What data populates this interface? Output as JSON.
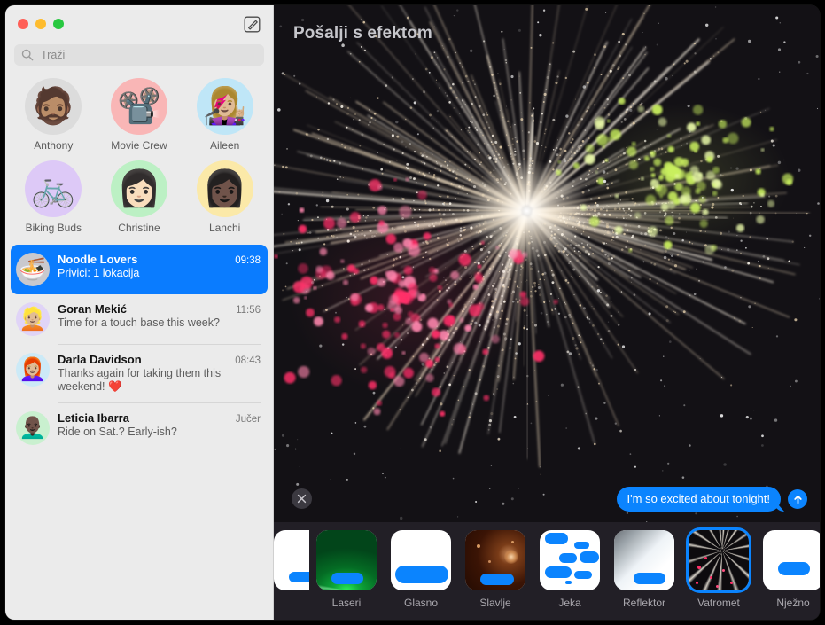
{
  "window": {
    "traffic_lights": [
      "close",
      "minimize",
      "zoom"
    ],
    "compose_icon": "compose-icon"
  },
  "sidebar": {
    "search": {
      "placeholder": "Traži",
      "value": "",
      "icon": "search-icon"
    },
    "pinned": [
      {
        "label": "Anthony",
        "glyph": "🧔🏽",
        "bg": "#dcdcdc"
      },
      {
        "label": "Movie Crew",
        "glyph": "📽️",
        "bg": "#f9b6b6"
      },
      {
        "label": "Aileen",
        "glyph": "👩🏼‍🎤",
        "bg": "#bfe6f7"
      },
      {
        "label": "Biking Buds",
        "glyph": "🚲",
        "bg": "#ddc9f7"
      },
      {
        "label": "Christine",
        "glyph": "👩🏻",
        "bg": "#bcf0c4"
      },
      {
        "label": "Lanchi",
        "glyph": "👩🏿",
        "bg": "#fbe9a8"
      }
    ],
    "conversations": [
      {
        "name": "Noodle Lovers",
        "time": "09:38",
        "preview": "Privici:  1 lokacija",
        "glyph": "🍜",
        "bg": "#c9c9ce",
        "selected": true
      },
      {
        "name": "Goran Mekić",
        "time": "11:56",
        "preview": "Time for a touch base this week?",
        "glyph": "👱🏼",
        "bg": "#e0d4f7",
        "selected": false
      },
      {
        "name": "Darla Davidson",
        "time": "08:43",
        "preview": "Thanks again for taking them this weekend! ❤️",
        "glyph": "👩🏼‍🦰",
        "bg": "#cceaf7",
        "selected": false
      },
      {
        "name": "Leticia Ibarra",
        "time": "Jučer",
        "preview": "Ride on Sat.? Early-ish?",
        "glyph": "👨🏿‍🦲",
        "bg": "#c9f0cf",
        "selected": false
      }
    ]
  },
  "effect_pane": {
    "title": "Pošalji s efektom",
    "close_icon": "close-icon",
    "send_icon": "send-arrow-icon",
    "message_text": "I'm so excited about tonight!",
    "accent_color": "#0b84fe",
    "effects": [
      {
        "label": "",
        "style": "plain",
        "selected": false,
        "partial": true
      },
      {
        "label": "Laseri",
        "style": "lasers",
        "selected": false,
        "partial": false
      },
      {
        "label": "Glasno",
        "style": "loud",
        "selected": false,
        "partial": false
      },
      {
        "label": "Slavlje",
        "style": "celebrate",
        "selected": false,
        "partial": false
      },
      {
        "label": "Jeka",
        "style": "echo",
        "selected": false,
        "partial": false
      },
      {
        "label": "Reflektor",
        "style": "spotlight",
        "selected": false,
        "partial": false
      },
      {
        "label": "Vatromet",
        "style": "fireworks",
        "selected": true,
        "partial": false
      },
      {
        "label": "Nježno",
        "style": "gentle",
        "selected": false,
        "partial": false
      }
    ]
  }
}
